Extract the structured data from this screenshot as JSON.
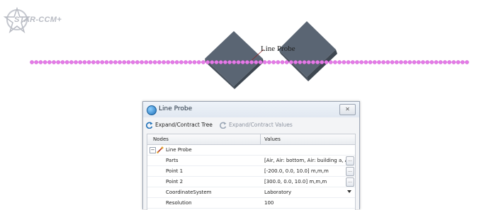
{
  "app": {
    "logo_text": "STAR-CCM+"
  },
  "viewport": {
    "probe_label": "Line Probe",
    "colors": {
      "probe_line": "#e57ae8",
      "solid": "#5a6573"
    }
  },
  "dialog": {
    "title": "Line Probe",
    "close_glyph": "✕",
    "toolbar": {
      "expand_tree_label": "Expand/Contract Tree",
      "expand_values_label": "Expand/Contract Values"
    },
    "table": {
      "columns": [
        "Nodes",
        "Values"
      ],
      "root": {
        "toggle": "−",
        "label": "Line Probe"
      },
      "rows": [
        {
          "node": "Parts",
          "value": "[Air, Air: bottom, Air: building a, Air:",
          "control": "ellipsis"
        },
        {
          "node": "Point 1",
          "value": "[-200.0, 0.0, 10.0] m,m,m",
          "control": "ellipsis"
        },
        {
          "node": "Point 2",
          "value": "[300.0, 0.0, 10.0] m,m,m",
          "control": "ellipsis"
        },
        {
          "node": "CoordinateSystem",
          "value": "Laboratory",
          "control": "dropdown"
        },
        {
          "node": "Resolution",
          "value": "100",
          "control": "none"
        }
      ],
      "ellipsis_glyph": "..."
    }
  }
}
